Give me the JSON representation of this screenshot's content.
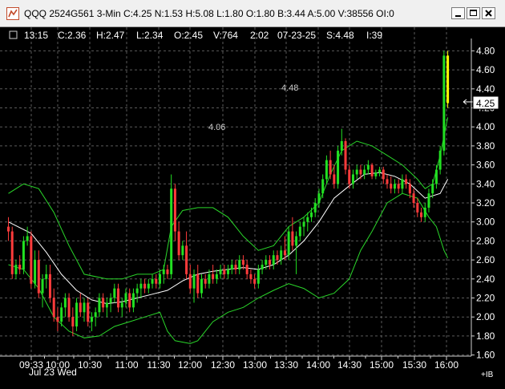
{
  "window": {
    "title": "QQQ 2524G561 3-Min C:4.25 N:1.53 H:5.08 L:1.80 O:1.80 B:3.44 A:5.00 V:38556 OI:0"
  },
  "info_bar": {
    "time": "13:15",
    "close": "C:2.36",
    "high": "H:2.47",
    "low": "L:2.34",
    "open": "O:2.45",
    "volume": "V:764",
    "span": "2:02",
    "date": "07-23-25",
    "s": "S:4.48",
    "i": "I:39"
  },
  "annotations": {
    "level_upper": "4.48",
    "level_lower": "4.06"
  },
  "current_price": "4.25",
  "date_label": "Jul 23 Wed",
  "corner_label": "+IB",
  "colors": {
    "up": "#22e022",
    "down": "#ff3b3b",
    "band": "#2ad62a",
    "ma": "#ffffff",
    "grid": "#5a5a5a",
    "last": "#ffff00"
  },
  "chart_data": {
    "type": "candlestick",
    "interval": "3-Min",
    "y_ticks": [
      "4.80",
      "4.60",
      "4.40",
      "4.20",
      "4.00",
      "3.80",
      "3.60",
      "3.40",
      "3.20",
      "3.00",
      "2.80",
      "2.60",
      "2.40",
      "2.20",
      "2.00",
      "1.80",
      "1.60"
    ],
    "x_ticks": [
      "09:33",
      "10:00",
      "10:30",
      "11:00",
      "11:30",
      "12:00",
      "12:30",
      "13:00",
      "13:30",
      "14:00",
      "14:30",
      "15:00",
      "15:30",
      "16:00"
    ],
    "ylim": [
      1.55,
      4.9
    ],
    "last_price": 4.25,
    "bars": [
      [
        2.95,
        3.05,
        2.8,
        2.9
      ],
      [
        2.9,
        2.95,
        2.4,
        2.45
      ],
      [
        2.45,
        2.6,
        2.4,
        2.55
      ],
      [
        2.55,
        2.65,
        2.45,
        2.5
      ],
      [
        2.5,
        2.85,
        2.45,
        2.8
      ],
      [
        2.8,
        2.95,
        2.75,
        2.85
      ],
      [
        2.85,
        2.9,
        2.3,
        2.35
      ],
      [
        2.35,
        2.7,
        2.3,
        2.6
      ],
      [
        2.6,
        2.7,
        2.2,
        2.25
      ],
      [
        2.25,
        2.45,
        2.1,
        2.4
      ],
      [
        2.4,
        2.55,
        2.3,
        2.45
      ],
      [
        2.45,
        2.55,
        2.15,
        2.2
      ],
      [
        2.2,
        2.3,
        1.95,
        2.0
      ],
      [
        2.0,
        2.1,
        1.85,
        1.95
      ],
      [
        1.95,
        2.15,
        1.9,
        2.1
      ],
      [
        2.1,
        2.25,
        2.0,
        2.2
      ],
      [
        2.2,
        2.25,
        1.95,
        2.0
      ],
      [
        2.0,
        2.1,
        1.8,
        1.9
      ],
      [
        1.9,
        2.2,
        1.85,
        2.15
      ],
      [
        2.15,
        2.25,
        2.0,
        2.05
      ],
      [
        2.05,
        2.2,
        1.95,
        2.15
      ],
      [
        2.15,
        2.2,
        1.9,
        1.95
      ],
      [
        1.95,
        2.05,
        1.85,
        2.0
      ],
      [
        2.0,
        2.1,
        1.9,
        2.05
      ],
      [
        2.05,
        2.25,
        2.0,
        2.2
      ],
      [
        2.2,
        2.25,
        2.05,
        2.1
      ],
      [
        2.1,
        2.2,
        2.0,
        2.15
      ],
      [
        2.15,
        2.25,
        2.05,
        2.2
      ],
      [
        2.2,
        2.35,
        2.15,
        2.3
      ],
      [
        2.3,
        2.35,
        2.05,
        2.1
      ],
      [
        2.1,
        2.2,
        2.0,
        2.15
      ],
      [
        2.15,
        2.3,
        2.1,
        2.25
      ],
      [
        2.25,
        2.3,
        2.05,
        2.1
      ],
      [
        2.1,
        2.3,
        2.05,
        2.25
      ],
      [
        2.25,
        2.35,
        2.15,
        2.3
      ],
      [
        2.3,
        2.4,
        2.2,
        2.35
      ],
      [
        2.35,
        2.4,
        2.25,
        2.3
      ],
      [
        2.3,
        2.4,
        2.25,
        2.35
      ],
      [
        2.35,
        2.45,
        2.3,
        2.4
      ],
      [
        2.4,
        2.45,
        2.3,
        2.35
      ],
      [
        2.35,
        2.5,
        2.3,
        2.45
      ],
      [
        2.45,
        2.55,
        2.35,
        2.5
      ],
      [
        2.5,
        2.55,
        2.4,
        2.45
      ],
      [
        2.45,
        3.5,
        2.4,
        3.35
      ],
      [
        3.35,
        3.4,
        2.8,
        2.9
      ],
      [
        2.9,
        3.0,
        2.6,
        2.65
      ],
      [
        2.65,
        2.8,
        2.6,
        2.75
      ],
      [
        2.75,
        2.9,
        2.4,
        2.45
      ],
      [
        2.45,
        2.55,
        2.25,
        2.3
      ],
      [
        2.3,
        2.5,
        2.15,
        2.45
      ],
      [
        2.45,
        2.55,
        2.2,
        2.25
      ],
      [
        2.25,
        2.45,
        2.2,
        2.4
      ],
      [
        2.4,
        2.45,
        2.3,
        2.35
      ],
      [
        2.35,
        2.5,
        2.3,
        2.45
      ],
      [
        2.45,
        2.55,
        2.35,
        2.4
      ],
      [
        2.4,
        2.5,
        2.35,
        2.45
      ],
      [
        2.45,
        2.55,
        2.4,
        2.5
      ],
      [
        2.5,
        2.55,
        2.4,
        2.45
      ],
      [
        2.45,
        2.55,
        2.4,
        2.5
      ],
      [
        2.5,
        2.6,
        2.45,
        2.55
      ],
      [
        2.55,
        2.6,
        2.45,
        2.5
      ],
      [
        2.5,
        2.65,
        2.45,
        2.6
      ],
      [
        2.6,
        2.65,
        2.5,
        2.55
      ],
      [
        2.55,
        2.6,
        2.4,
        2.45
      ],
      [
        2.45,
        2.5,
        2.35,
        2.4
      ],
      [
        2.4,
        2.45,
        2.3,
        2.35
      ],
      [
        2.35,
        2.55,
        2.3,
        2.5
      ],
      [
        2.5,
        2.6,
        2.45,
        2.55
      ],
      [
        2.55,
        2.65,
        2.5,
        2.6
      ],
      [
        2.6,
        2.65,
        2.5,
        2.55
      ],
      [
        2.55,
        2.7,
        2.5,
        2.65
      ],
      [
        2.65,
        2.7,
        2.55,
        2.6
      ],
      [
        2.6,
        2.75,
        2.55,
        2.7
      ],
      [
        2.7,
        2.85,
        2.6,
        2.65
      ],
      [
        2.65,
        2.95,
        2.6,
        2.9
      ],
      [
        2.9,
        3.05,
        2.7,
        2.75
      ],
      [
        2.75,
        2.9,
        2.45,
        2.85
      ],
      [
        2.85,
        3.0,
        2.8,
        2.95
      ],
      [
        2.95,
        3.05,
        2.85,
        3.0
      ],
      [
        3.0,
        3.1,
        2.9,
        3.05
      ],
      [
        3.05,
        3.15,
        3.0,
        3.1
      ],
      [
        3.1,
        3.25,
        3.05,
        3.2
      ],
      [
        3.2,
        3.35,
        3.15,
        3.3
      ],
      [
        3.3,
        3.5,
        3.25,
        3.45
      ],
      [
        3.45,
        3.7,
        3.4,
        3.65
      ],
      [
        3.65,
        3.75,
        3.45,
        3.5
      ],
      [
        3.5,
        3.6,
        3.35,
        3.4
      ],
      [
        3.4,
        3.8,
        3.35,
        3.75
      ],
      [
        3.75,
        3.98,
        3.7,
        3.85
      ],
      [
        3.85,
        3.88,
        3.5,
        3.55
      ],
      [
        3.55,
        3.6,
        3.35,
        3.4
      ],
      [
        3.4,
        3.55,
        3.35,
        3.5
      ],
      [
        3.5,
        3.6,
        3.45,
        3.55
      ],
      [
        3.55,
        3.6,
        3.45,
        3.5
      ],
      [
        3.5,
        3.6,
        3.45,
        3.55
      ],
      [
        3.55,
        3.65,
        3.5,
        3.6
      ],
      [
        3.6,
        3.62,
        3.45,
        3.48
      ],
      [
        3.48,
        3.55,
        3.45,
        3.52
      ],
      [
        3.52,
        3.58,
        3.48,
        3.55
      ],
      [
        3.55,
        3.58,
        3.4,
        3.45
      ],
      [
        3.45,
        3.5,
        3.35,
        3.4
      ],
      [
        3.4,
        3.48,
        3.3,
        3.35
      ],
      [
        3.35,
        3.45,
        3.3,
        3.4
      ],
      [
        3.4,
        3.45,
        3.3,
        3.35
      ],
      [
        3.35,
        3.5,
        3.3,
        3.45
      ],
      [
        3.45,
        3.5,
        3.35,
        3.4
      ],
      [
        3.4,
        3.45,
        3.25,
        3.3
      ],
      [
        3.3,
        3.35,
        3.15,
        3.2
      ],
      [
        3.2,
        3.25,
        3.05,
        3.1
      ],
      [
        3.1,
        3.15,
        3.0,
        3.05
      ],
      [
        3.05,
        3.2,
        3.0,
        3.15
      ],
      [
        3.15,
        3.35,
        3.1,
        3.3
      ],
      [
        3.3,
        3.45,
        3.25,
        3.4
      ],
      [
        3.4,
        3.6,
        3.35,
        3.55
      ],
      [
        3.55,
        3.8,
        3.5,
        3.75
      ],
      [
        3.75,
        4.8,
        3.7,
        4.75
      ],
      [
        4.75,
        4.8,
        4.2,
        4.25
      ]
    ],
    "ma": [
      [
        0,
        3.0
      ],
      [
        6,
        2.88
      ],
      [
        10,
        2.68
      ],
      [
        14,
        2.45
      ],
      [
        18,
        2.28
      ],
      [
        22,
        2.18
      ],
      [
        26,
        2.14
      ],
      [
        30,
        2.16
      ],
      [
        34,
        2.2
      ],
      [
        38,
        2.24
      ],
      [
        42,
        2.28
      ],
      [
        46,
        2.38
      ],
      [
        50,
        2.45
      ],
      [
        54,
        2.48
      ],
      [
        58,
        2.5
      ],
      [
        62,
        2.52
      ],
      [
        66,
        2.5
      ],
      [
        70,
        2.55
      ],
      [
        74,
        2.65
      ],
      [
        78,
        2.8
      ],
      [
        82,
        3.0
      ],
      [
        86,
        3.25
      ],
      [
        90,
        3.38
      ],
      [
        94,
        3.5
      ],
      [
        98,
        3.52
      ],
      [
        102,
        3.48
      ],
      [
        106,
        3.4
      ],
      [
        110,
        3.25
      ],
      [
        114,
        3.3
      ],
      [
        116,
        3.45
      ]
    ],
    "band_upper": [
      [
        0,
        3.3
      ],
      [
        4,
        3.4
      ],
      [
        8,
        3.35
      ],
      [
        12,
        3.1
      ],
      [
        16,
        2.75
      ],
      [
        20,
        2.45
      ],
      [
        26,
        2.4
      ],
      [
        30,
        2.4
      ],
      [
        34,
        2.45
      ],
      [
        38,
        2.45
      ],
      [
        41,
        2.5
      ],
      [
        43,
        2.95
      ],
      [
        46,
        3.12
      ],
      [
        50,
        3.15
      ],
      [
        54,
        3.15
      ],
      [
        58,
        3.05
      ],
      [
        62,
        2.85
      ],
      [
        66,
        2.7
      ],
      [
        70,
        2.75
      ],
      [
        74,
        2.95
      ],
      [
        78,
        3.05
      ],
      [
        82,
        3.2
      ],
      [
        85,
        3.5
      ],
      [
        88,
        3.75
      ],
      [
        90,
        3.8
      ],
      [
        92,
        3.85
      ],
      [
        96,
        3.8
      ],
      [
        100,
        3.7
      ],
      [
        104,
        3.6
      ],
      [
        108,
        3.45
      ],
      [
        110,
        3.35
      ],
      [
        112,
        3.4
      ],
      [
        114,
        3.7
      ],
      [
        116,
        4.1
      ]
    ],
    "band_lower": [
      [
        0,
        2.55
      ],
      [
        4,
        2.5
      ],
      [
        8,
        2.3
      ],
      [
        12,
        2.0
      ],
      [
        16,
        1.85
      ],
      [
        20,
        1.78
      ],
      [
        24,
        1.8
      ],
      [
        28,
        1.9
      ],
      [
        32,
        1.95
      ],
      [
        36,
        2.0
      ],
      [
        40,
        2.05
      ],
      [
        42,
        1.85
      ],
      [
        44,
        1.75
      ],
      [
        48,
        1.72
      ],
      [
        50,
        1.75
      ],
      [
        54,
        1.95
      ],
      [
        58,
        2.05
      ],
      [
        62,
        2.1
      ],
      [
        66,
        2.2
      ],
      [
        70,
        2.28
      ],
      [
        74,
        2.35
      ],
      [
        78,
        2.3
      ],
      [
        82,
        2.2
      ],
      [
        86,
        2.25
      ],
      [
        90,
        2.4
      ],
      [
        93,
        2.7
      ],
      [
        96,
        2.9
      ],
      [
        100,
        3.2
      ],
      [
        104,
        3.3
      ],
      [
        108,
        3.25
      ],
      [
        111,
        3.05
      ],
      [
        113,
        2.95
      ],
      [
        115,
        2.7
      ],
      [
        116,
        2.62
      ]
    ]
  }
}
